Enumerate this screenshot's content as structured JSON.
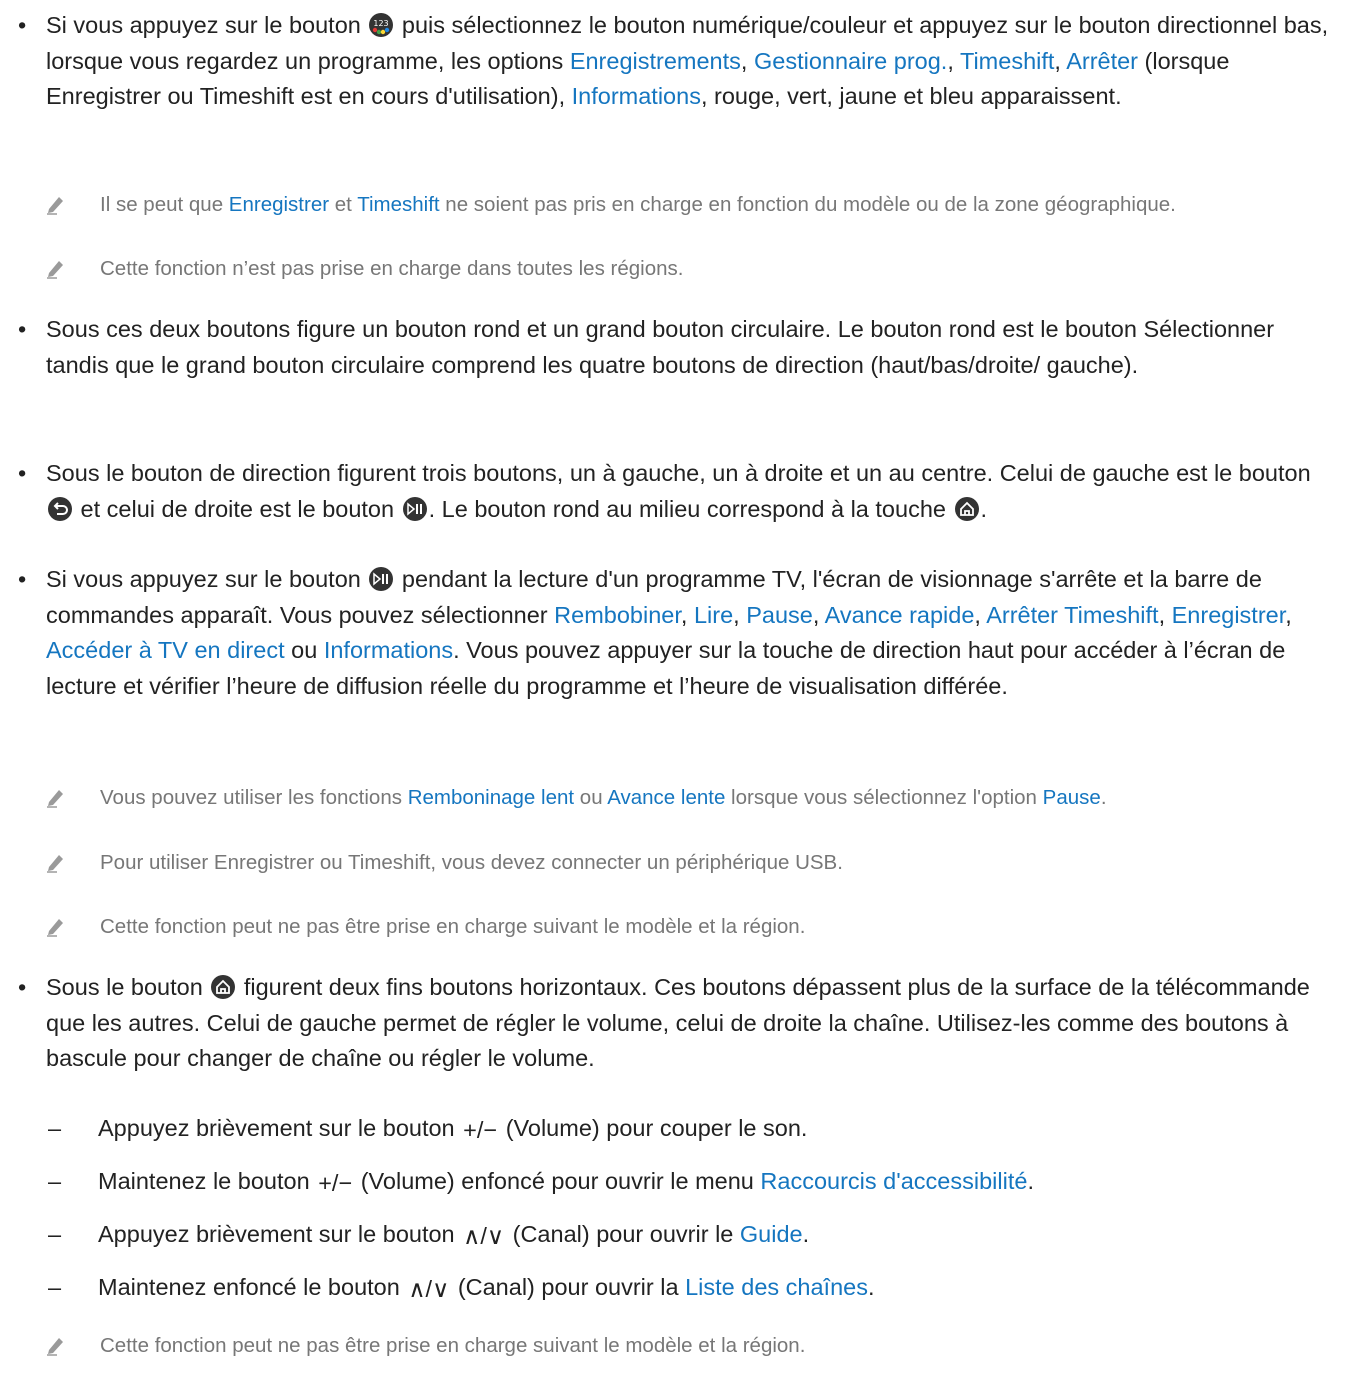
{
  "colors": {
    "text": "#222222",
    "link": "#1576c0",
    "note": "#777777"
  },
  "b1": {
    "t1": "Si vous appuyez sur le bouton",
    "t2": "puis sélectionnez le bouton numérique/couleur et appuyez sur le bouton directionnel bas, lorsque vous regardez un programme, les options",
    "l1": "Enregistrements",
    "l2": "Gestionnaire prog.",
    "l3": "Timeshift",
    "l4": "Arrêter",
    "t3": "(lorsque Enregistrer ou Timeshift est en cours d'utilisation),",
    "l5": "Informations",
    "t4": ", rouge, vert, jaune et bleu apparaissent."
  },
  "n1": {
    "t1": "Il se peut que",
    "l1": "Enregistrer",
    "t2": "et",
    "l2": "Timeshift",
    "t3": "ne soient pas pris en charge en fonction du modèle ou de la zone géographique."
  },
  "n2": "Cette fonction n’est pas prise en charge dans toutes les régions.",
  "b2": "Sous ces deux boutons figure un bouton rond et un grand bouton circulaire. Le bouton rond est le bouton Sélectionner tandis que le grand bouton circulaire comprend les quatre boutons de direction (haut/bas/droite/ gauche).",
  "b3": {
    "t1": "Sous le bouton de direction figurent trois boutons, un à gauche, un à droite et un au centre. Celui de gauche est le bouton",
    "t2": "et celui de droite est le bouton",
    "t3": ". Le bouton rond au milieu correspond à la touche",
    "t4": "."
  },
  "b4": {
    "t1": "Si vous appuyez sur le bouton",
    "t2": "pendant la lecture d'un programme TV, l'écran de visionnage s'arrête et la barre de commandes apparaît. Vous pouvez sélectionner",
    "l1": "Rembobiner",
    "l2": "Lire",
    "l3": "Pause",
    "l4": "Avance rapide",
    "l5": "Arrêter Timeshift",
    "l6": "Enregistrer",
    "l7": "Accéder à TV en direct",
    "t3": "ou",
    "l8": "Informations",
    "t4": ". Vous pouvez appuyer sur la touche de direction haut pour accéder à l’écran de lecture et vérifier l’heure de diffusion réelle du programme et l’heure de visualisation différée."
  },
  "n3": {
    "t1": "Vous pouvez utiliser les fonctions",
    "l1": "Remboninage lent",
    "t2": "ou",
    "l2": "Avance lente",
    "t3": "lorsque vous sélectionnez l'option",
    "l3": "Pause",
    "t4": "."
  },
  "n4": "Pour utiliser Enregistrer ou Timeshift, vous devez connecter un périphérique USB.",
  "n5": "Cette fonction peut ne pas être prise en charge suivant le modèle et la région.",
  "b5": {
    "t1": "Sous le bouton",
    "t2": "figurent deux fins boutons horizontaux. Ces boutons dépassent plus de la surface de la télécommande que les autres. Celui de gauche permet de régler le volume, celui de droite la chaîne. Utilisez-les comme des boutons à bascule pour changer de chaîne ou régler le volume."
  },
  "d1": {
    "t1": "Appuyez brièvement sur le bouton",
    "sym": "+/−",
    "t2": "(Volume) pour couper le son."
  },
  "d2": {
    "t1": "Maintenez le bouton",
    "sym": "+/−",
    "t2": "(Volume) enfoncé pour ouvrir le menu",
    "l1": "Raccourcis d'accessibilité",
    "t3": "."
  },
  "d3": {
    "t1": "Appuyez brièvement sur le bouton",
    "sym": "∧/∨",
    "t2": "(Canal) pour ouvrir le",
    "l1": "Guide",
    "t3": "."
  },
  "d4": {
    "t1": "Maintenez enfoncé le bouton",
    "sym": "∧/∨",
    "t2": "(Canal) pour ouvrir la",
    "l1": "Liste des chaînes",
    "t3": "."
  },
  "n6": "Cette fonction peut ne pas être prise en charge suivant le modèle et la région.",
  "bullet_char": "•",
  "dash_char": "–",
  "icons": [
    "color-numeric-button-icon",
    "pencil-note-icon",
    "back-button-icon",
    "play-pause-button-icon",
    "home-button-icon"
  ]
}
